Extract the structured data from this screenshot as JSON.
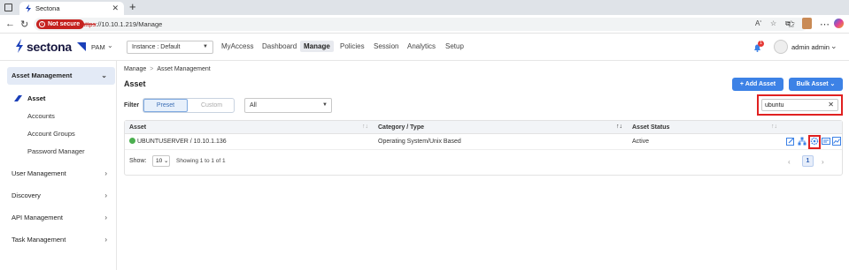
{
  "browser": {
    "tab_title": "Sectona",
    "tab_close": "✕",
    "new_tab": "+",
    "not_secure": "Not secure",
    "url_scheme": "https",
    "url_rest": "://10.10.1.219/Manage",
    "read_aloud": "Aʹ",
    "win_min": "—",
    "win_max": "☐",
    "win_close": "✕"
  },
  "app": {
    "logo": "sectona",
    "product": "PAM",
    "instance": "Instance : Default",
    "nav": [
      "MyAccess",
      "Dashboard",
      "Manage",
      "Policies",
      "Session",
      "Analytics",
      "Setup"
    ],
    "active_nav": "Manage",
    "notification_count": "1",
    "user_name": "admin admin"
  },
  "sidebar": {
    "groups": [
      {
        "label": "Asset Management",
        "open": true
      },
      {
        "label": "User Management"
      },
      {
        "label": "Discovery"
      },
      {
        "label": "API Management"
      },
      {
        "label": "Task Management"
      }
    ],
    "subitems": [
      "Asset",
      "Accounts",
      "Account Groups",
      "Password Manager"
    ],
    "active_sub": "Asset"
  },
  "main": {
    "breadcrumb": [
      "Manage",
      "Asset Management"
    ],
    "title": "Asset",
    "add_button": "+ Add Asset",
    "bulk_button": "Bulk Asset",
    "filter_label": "Filter",
    "filter_tabs": [
      "Preset",
      "Custom"
    ],
    "filter_select": "All",
    "search_value": "ubuntu",
    "table": {
      "headers": [
        "Asset",
        "Category / Type",
        "Asset Status"
      ],
      "rows": [
        {
          "asset": "UBUNTUSERVER / 10.10.1.136",
          "category": "Operating System/Unix Based",
          "status": "Active"
        }
      ],
      "row_actions": [
        "edit-icon",
        "hierarchy-icon",
        "settings-icon",
        "card-icon",
        "chart-icon"
      ]
    },
    "footer": {
      "show_label": "Show:",
      "page_size": "10",
      "showing": "Showing 1 to 1 of 1",
      "current_page": "1"
    }
  },
  "colors": {
    "accent": "#3d82e6",
    "highlight": "#e02020",
    "active_status": "#4caf50"
  }
}
